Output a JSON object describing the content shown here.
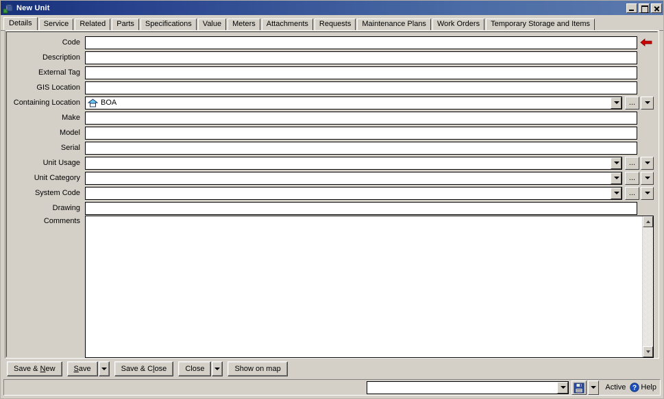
{
  "window": {
    "title": "New Unit",
    "icon": "unit-box-icon",
    "controls": {
      "minimize": "minimize-icon",
      "maximize": "maximize-icon",
      "close": "close-icon"
    }
  },
  "tabs": [
    {
      "label": "Details",
      "active": true
    },
    {
      "label": "Service",
      "active": false
    },
    {
      "label": "Related",
      "active": false
    },
    {
      "label": "Parts",
      "active": false
    },
    {
      "label": "Specifications",
      "active": false
    },
    {
      "label": "Value",
      "active": false
    },
    {
      "label": "Meters",
      "active": false
    },
    {
      "label": "Attachments",
      "active": false
    },
    {
      "label": "Requests",
      "active": false
    },
    {
      "label": "Maintenance Plans",
      "active": false
    },
    {
      "label": "Work Orders",
      "active": false
    },
    {
      "label": "Temporary Storage and Items",
      "active": false
    }
  ],
  "form": {
    "fields": [
      {
        "label": "Code",
        "value": "",
        "type": "text",
        "required_marker": true
      },
      {
        "label": "Description",
        "value": "",
        "type": "text"
      },
      {
        "label": "External Tag",
        "value": "",
        "type": "text"
      },
      {
        "label": "GIS Location",
        "value": "",
        "type": "text"
      },
      {
        "label": "Containing Location",
        "value": "BOA",
        "type": "combo-lookup",
        "icon": "home-icon"
      },
      {
        "label": "Make",
        "value": "",
        "type": "text"
      },
      {
        "label": "Model",
        "value": "",
        "type": "text"
      },
      {
        "label": "Serial",
        "value": "",
        "type": "text"
      },
      {
        "label": "Unit Usage",
        "value": "",
        "type": "combo-lookup"
      },
      {
        "label": "Unit Category",
        "value": "",
        "type": "combo-lookup"
      },
      {
        "label": "System Code",
        "value": "",
        "type": "combo-lookup"
      },
      {
        "label": "Drawing",
        "value": "",
        "type": "text"
      }
    ],
    "comments": {
      "label": "Comments",
      "value": ""
    },
    "lookup_button_label": "...",
    "required_marker": "red-left-arrow-icon"
  },
  "buttons": [
    {
      "name": "save-and-new",
      "pre": "Save & ",
      "accel": "N",
      "post": "ew",
      "split": false
    },
    {
      "name": "save",
      "pre": "",
      "accel": "S",
      "post": "ave",
      "split": true
    },
    {
      "name": "save-and-close",
      "pre": "Save & C",
      "accel": "l",
      "post": "ose",
      "split": false
    },
    {
      "name": "close",
      "pre": "Close",
      "accel": "",
      "post": "",
      "split": true
    },
    {
      "name": "show-on-map",
      "pre": "Show on map",
      "accel": "",
      "post": "",
      "split": false
    }
  ],
  "statusbar": {
    "combo_value": "",
    "save_icon": "floppy-disk-icon",
    "dropdown_icon": "chevron-down-icon",
    "status_text": "Active",
    "help_label": "Help",
    "help_icon": "help-question-icon"
  },
  "colors": {
    "window_face": "#d4d0c8",
    "titlebar_start": "#17307a",
    "titlebar_end": "#5b79ad",
    "field_bg": "#ffffff",
    "required_arrow": "#cc0000",
    "home_roof": "#6cc8f0",
    "help_blue": "#1a50b8"
  }
}
